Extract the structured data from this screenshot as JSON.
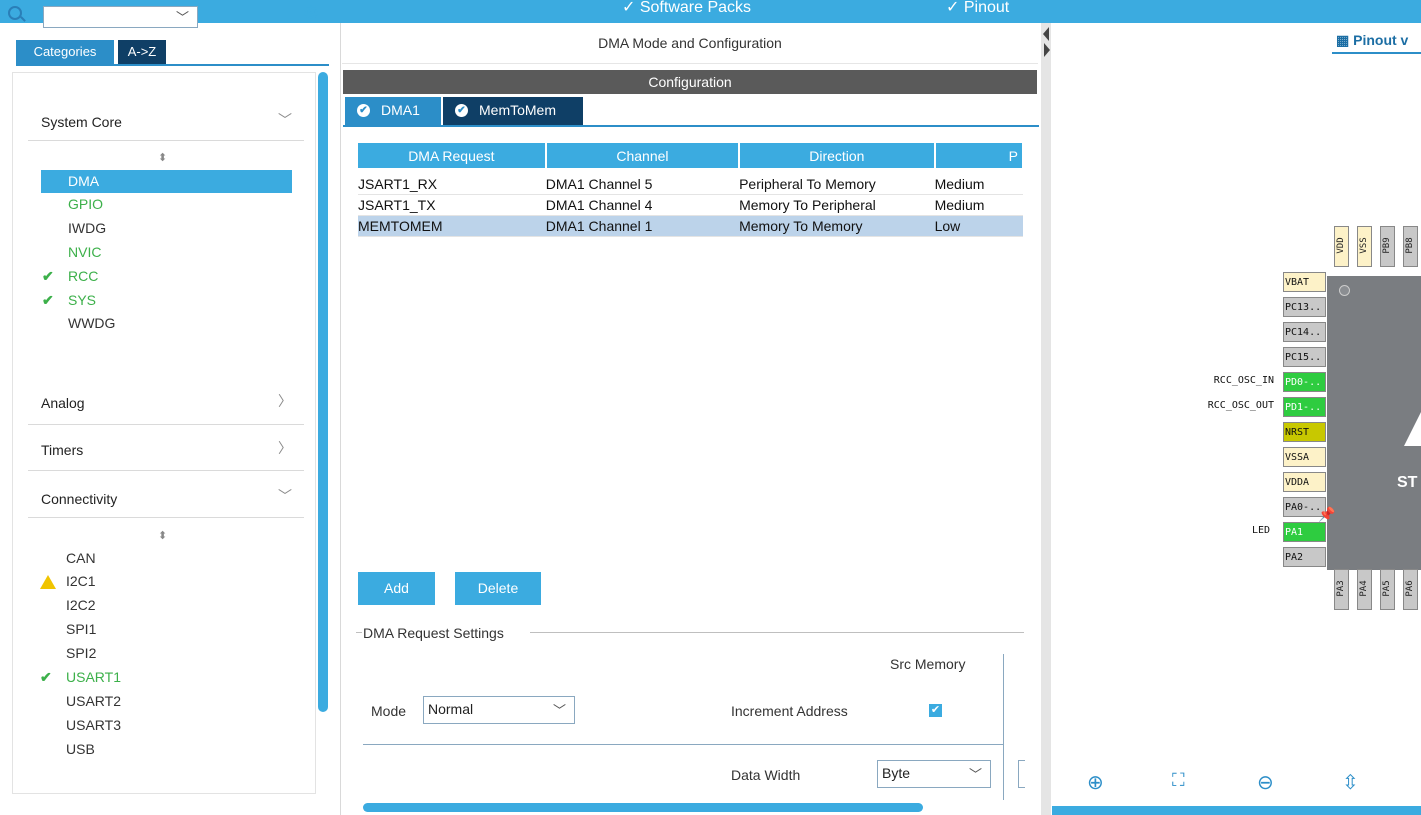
{
  "topbar": {
    "software_packs": "✓ Software Packs",
    "pinout": "✓ Pinout"
  },
  "left": {
    "tabs": {
      "categories": "Categories",
      "az": "A->Z"
    },
    "categories": {
      "system_core": "System Core",
      "analog": "Analog",
      "timers": "Timers",
      "connectivity": "Connectivity"
    },
    "system_core_items": [
      "DMA",
      "GPIO",
      "IWDG",
      "NVIC",
      "RCC",
      "SYS",
      "WWDG"
    ],
    "connectivity_items": [
      "CAN",
      "I2C1",
      "I2C2",
      "SPI1",
      "SPI2",
      "USART1",
      "USART2",
      "USART3",
      "USB"
    ]
  },
  "middle": {
    "title": "DMA Mode and Configuration",
    "config_bar": "Configuration",
    "tabs": [
      "DMA1",
      "MemToMem"
    ],
    "table": {
      "headers": [
        "DMA Request",
        "Channel",
        "Direction",
        "P"
      ],
      "rows": [
        [
          "JSART1_RX",
          "DMA1 Channel 5",
          "Peripheral To Memory",
          "Medium"
        ],
        [
          "JSART1_TX",
          "DMA1 Channel 4",
          "Memory To Peripheral",
          "Medium"
        ],
        [
          "MEMTOMEM",
          "DMA1 Channel 1",
          "Memory To Memory",
          "Low"
        ]
      ]
    },
    "buttons": {
      "add": "Add",
      "delete": "Delete"
    },
    "settings": {
      "legend": "DMA Request Settings",
      "src_memory": "Src Memory",
      "mode_label": "Mode",
      "mode_value": "Normal",
      "increment_address": "Increment Address",
      "data_width_label": "Data Width",
      "data_width_value": "Byte"
    }
  },
  "right": {
    "title": "Pinout v",
    "left_pins": [
      "VBAT",
      "PC13..",
      "PC14..",
      "PC15..",
      "PD0-..",
      "PD1-..",
      "NRST",
      "VSSA",
      "VDDA",
      "PA0-..",
      "PA1",
      "PA2"
    ],
    "pin_labels": {
      "rcc_osc_in": "RCC_OSC_IN",
      "rcc_osc_out": "RCC_OSC_OUT",
      "led": "LED"
    },
    "top_pins": [
      "VDD",
      "VSS",
      "PB9",
      "PB8"
    ],
    "bottom_pins": [
      "PA3",
      "PA4",
      "PA5",
      "PA6"
    ],
    "chip_text": "ST",
    "colors": {
      "green_pin": "#2ecc40",
      "olive_pin": "#c8c800",
      "accent": "#3babe0"
    }
  }
}
